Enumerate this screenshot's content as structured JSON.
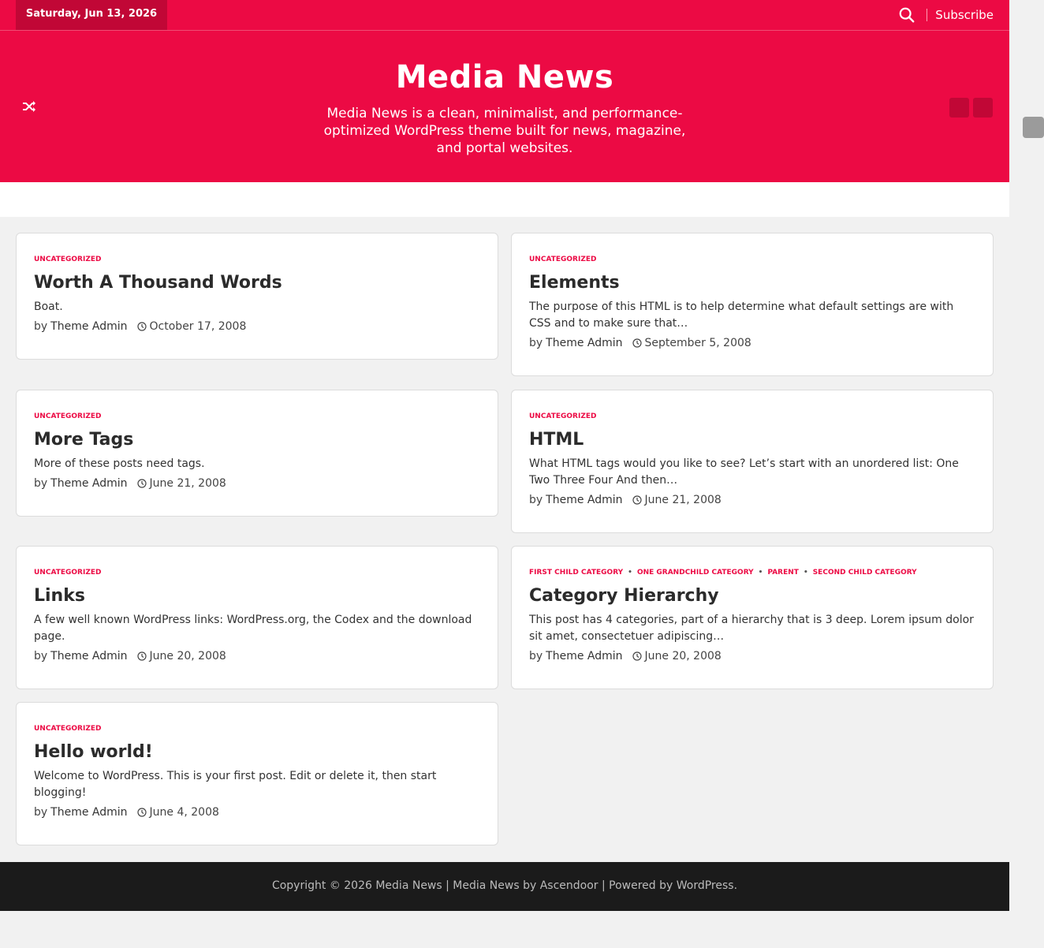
{
  "topbar": {
    "date": "Saturday, Jun 13, 2026",
    "subscribe_label": "Subscribe"
  },
  "header": {
    "title": "Media News",
    "tagline": "Media News is a clean, minimalist, and performance-optimized WordPress theme built for news, magazine, and portal websites."
  },
  "posts": [
    {
      "categories": [
        "Uncategorized"
      ],
      "title": "Worth A Thousand Words",
      "excerpt": "Boat.",
      "by": "by",
      "author": "Theme Admin",
      "date": "October 17, 2008"
    },
    {
      "categories": [
        "Uncategorized"
      ],
      "title": "Elements",
      "excerpt": "The purpose of this HTML is to help determine what default settings are with CSS and to make sure that…",
      "by": "by",
      "author": "Theme Admin",
      "date": "September 5, 2008"
    },
    {
      "categories": [
        "Uncategorized"
      ],
      "title": "More Tags",
      "excerpt": "More of these posts need tags.",
      "by": "by",
      "author": "Theme Admin",
      "date": "June 21, 2008"
    },
    {
      "categories": [
        "Uncategorized"
      ],
      "title": "HTML",
      "excerpt": "What HTML tags would you like to see? Let’s start with an unordered list: One Two Three Four And then…",
      "by": "by",
      "author": "Theme Admin",
      "date": "June 21, 2008"
    },
    {
      "categories": [
        "Uncategorized"
      ],
      "title": "Links",
      "excerpt": "A few well known WordPress links: WordPress.org, the Codex and the download page.",
      "by": "by",
      "author": "Theme Admin",
      "date": "June 20, 2008"
    },
    {
      "categories": [
        "First Child Category",
        "One Grandchild Category",
        "Parent",
        "Second Child Category"
      ],
      "title": "Category Hierarchy",
      "excerpt": "This post has 4 categories, part of a hierarchy that is 3 deep. Lorem ipsum dolor sit amet, consectetuer adipiscing…",
      "by": "by",
      "author": "Theme Admin",
      "date": "June 20, 2008"
    },
    {
      "categories": [
        "Uncategorized"
      ],
      "title": "Hello world!",
      "excerpt": "Welcome to WordPress. This is your first post. Edit or delete it, then start blogging!",
      "by": "by",
      "author": "Theme Admin",
      "date": "June 4, 2008"
    }
  ],
  "footer": {
    "copyright": "Copyright © 2026",
    "site_link": "Media News",
    "sep1": " | ",
    "theme_link": "Media News",
    "by_text": " by ",
    "author_link": "Ascendoor",
    "sep2": " | Powered by ",
    "wp_link": "WordPress",
    "end": "."
  },
  "colors": {
    "accent": "#ec0a44",
    "accent_dark": "#c10736",
    "footer_bg": "#1b1b1b"
  }
}
